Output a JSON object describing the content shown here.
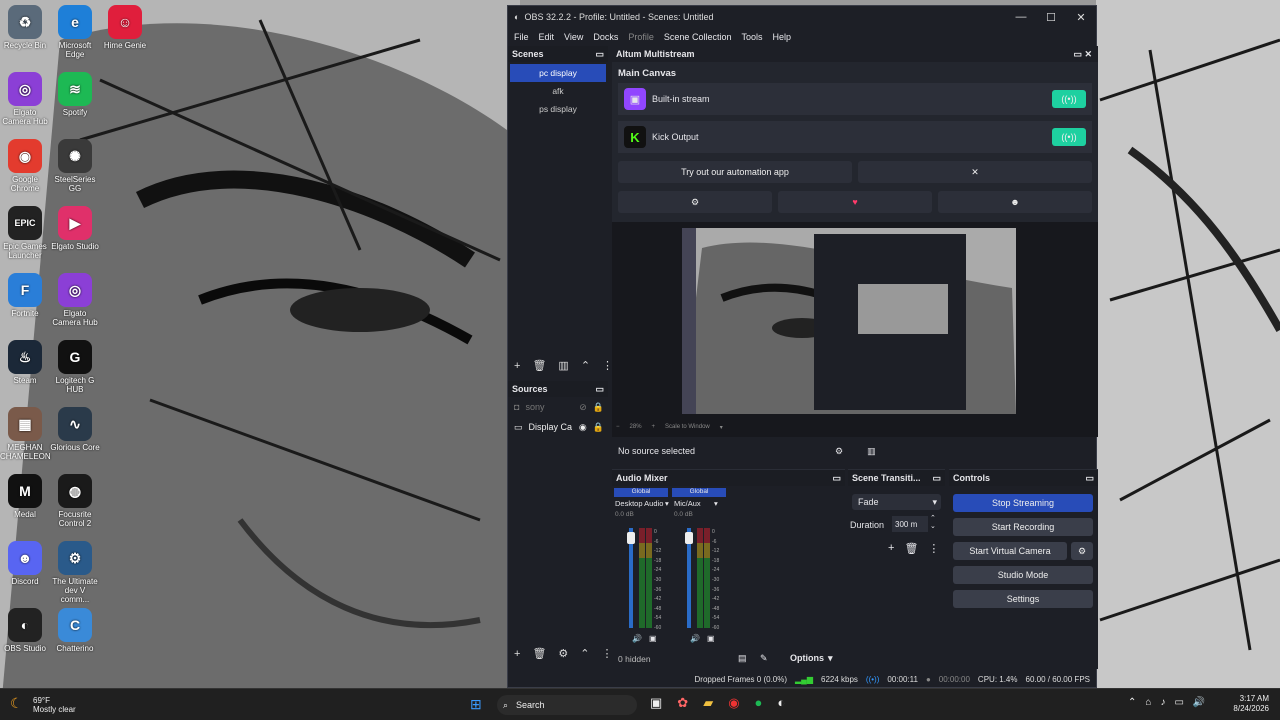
{
  "desktop": {
    "icons": [
      {
        "label": "Recycle Bin",
        "color": "#5a6a7a",
        "glyph": "♻"
      },
      {
        "label": "Microsoft Edge",
        "color": "#1e7fd8",
        "glyph": "e"
      },
      {
        "label": "Hime Genie",
        "color": "#e01e3c",
        "glyph": "☺"
      },
      {
        "label": "Elgato Camera Hub",
        "color": "#8b3fd6",
        "glyph": "◎"
      },
      {
        "label": "Spotify",
        "color": "#1db954",
        "glyph": "≋"
      },
      {
        "label": "Google Chrome",
        "color": "#e33b2e",
        "glyph": "◉"
      },
      {
        "label": "SteelSeries GG",
        "color": "#3a3a3a",
        "glyph": "✺"
      },
      {
        "label": "Epic Games Launcher",
        "color": "#222",
        "glyph": "EPIC"
      },
      {
        "label": "Elgato Studio",
        "color": "#e0306a",
        "glyph": "▶"
      },
      {
        "label": "Fortnite",
        "color": "#2a7ed8",
        "glyph": "F"
      },
      {
        "label": "Elgato Camera Hub",
        "color": "#8b3fd6",
        "glyph": "◎"
      },
      {
        "label": "Steam",
        "color": "#1b2838",
        "glyph": "♨"
      },
      {
        "label": "Logitech G HUB",
        "color": "#111",
        "glyph": "G"
      },
      {
        "label": "MEGHAN CHAMELEON",
        "color": "#7a5a4a",
        "glyph": "▦"
      },
      {
        "label": "Glorious Core",
        "color": "#2a3a4a",
        "glyph": "∿"
      },
      {
        "label": "Medal",
        "color": "#111",
        "glyph": "M"
      },
      {
        "label": "Focusrite Control 2",
        "color": "#1a1a1a",
        "glyph": "◍"
      },
      {
        "label": "Discord",
        "color": "#5865f2",
        "glyph": "☻"
      },
      {
        "label": "The Ultimate dev V comm...",
        "color": "#2a5a8a",
        "glyph": "⚙"
      },
      {
        "label": "OBS Studio",
        "color": "#222",
        "glyph": "◐"
      },
      {
        "label": "Chatterino",
        "color": "#3a8ad8",
        "glyph": "C"
      }
    ]
  },
  "window": {
    "title": "OBS 32.2.2 - Profile: Untitled - Scenes: Untitled",
    "controls": [
      "—",
      "☐",
      "✕"
    ],
    "menu": [
      "File",
      "Edit",
      "View",
      "Docks",
      "Profile",
      "Scene Collection",
      "Tools",
      "Help"
    ]
  },
  "scenes": {
    "header": "Scenes",
    "items": [
      "pc display",
      "afk",
      "ps display"
    ]
  },
  "altum": {
    "header": "Altum Multistream",
    "canvas_title": "Main Canvas",
    "outputs": [
      {
        "name": "Built-in stream",
        "icon": "twitch-icon",
        "color": "#9146ff"
      },
      {
        "name": "Kick Output",
        "icon": "kick-icon",
        "color": "#53fc18"
      }
    ],
    "automation_text": "Try out our automation app",
    "close_glyph": "✕"
  },
  "preview": {
    "zoom": "28%",
    "scale_mode": "Scale to Window"
  },
  "sources": {
    "header": "Sources",
    "items": [
      {
        "name": "sony",
        "hidden": true
      },
      {
        "name": "Display Ca",
        "hidden": false
      }
    ],
    "no_source": "No source selected",
    "hidden_count": "0 hidden"
  },
  "mixer": {
    "header": "Audio Mixer",
    "channels": [
      {
        "tag": "Global",
        "name": "Desktop Audio",
        "db": "0.0 dB"
      },
      {
        "tag": "Global",
        "name": "Mic/Aux",
        "db": "0.0 dB"
      }
    ],
    "scale": [
      "0",
      "-6",
      "-12",
      "-18",
      "-24",
      "-30",
      "-36",
      "-42",
      "-48",
      "-54",
      "-60"
    ],
    "options": "Options"
  },
  "transitions": {
    "header": "Scene Transiti...",
    "type": "Fade",
    "duration_label": "Duration",
    "duration_value": "300 m"
  },
  "controls": {
    "header": "Controls",
    "stop_streaming": "Stop Streaming",
    "start_recording": "Start Recording",
    "start_virtual_camera": "Start Virtual Camera",
    "studio_mode": "Studio Mode",
    "settings": "Settings"
  },
  "status": {
    "dropped": "Dropped Frames 0 (0.0%)",
    "bitrate": "6224 kbps",
    "stream_time": "00:00:11",
    "rec_time": "00:00:00",
    "cpu": "CPU: 1.4%",
    "fps": "60.00 / 60.00 FPS"
  },
  "taskbar": {
    "weather_temp": "69°F",
    "weather_desc": "Mostly clear",
    "search": "Search",
    "time": "3:17 AM",
    "date": "8/24/2026"
  },
  "colors": {
    "accent": "#284cb8",
    "live_green": "#1ed0a0",
    "panel": "#1d1f26"
  }
}
